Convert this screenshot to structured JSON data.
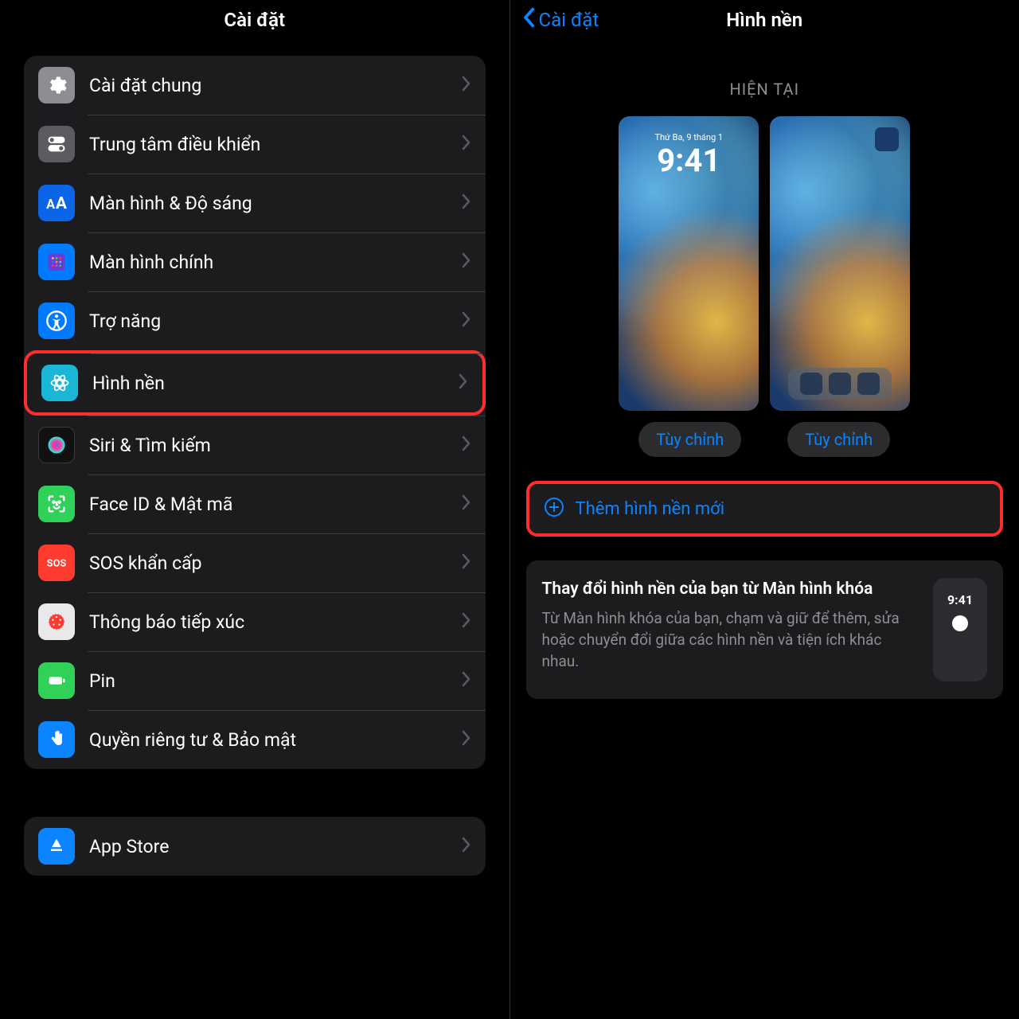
{
  "left": {
    "title": "Cài đặt",
    "rows": [
      {
        "label": "Cài đặt chung",
        "icon": "gear-icon",
        "bg": "bg-gray"
      },
      {
        "label": "Trung tâm điều khiển",
        "icon": "toggles-icon",
        "bg": "bg-darkgray"
      },
      {
        "label": "Màn hình & Độ sáng",
        "icon": "text-size-icon",
        "bg": "bg-blue"
      },
      {
        "label": "Màn hình chính",
        "icon": "apps-grid-icon",
        "bg": "bg-blue2"
      },
      {
        "label": "Trợ năng",
        "icon": "accessibility-icon",
        "bg": "bg-blue2"
      },
      {
        "label": "Hình nền",
        "icon": "wallpaper-icon",
        "bg": "bg-cyan",
        "highlight": true
      },
      {
        "label": "Siri & Tìm kiếm",
        "icon": "siri-icon",
        "bg": "bg-black"
      },
      {
        "label": "Face ID & Mật mã",
        "icon": "faceid-icon",
        "bg": "bg-green"
      },
      {
        "label": "SOS khẩn cấp",
        "icon": "sos-icon",
        "bg": "bg-red"
      },
      {
        "label": "Thông báo tiếp xúc",
        "icon": "exposure-icon",
        "bg": "bg-white"
      },
      {
        "label": "Pin",
        "icon": "battery-icon",
        "bg": "bg-green2"
      },
      {
        "label": "Quyền riêng tư & Bảo mật",
        "icon": "hand-icon",
        "bg": "bg-blue3"
      }
    ],
    "extra_row": {
      "label": "App Store",
      "icon": "appstore-icon",
      "bg": "bg-blue4"
    }
  },
  "right": {
    "back": "Cài đặt",
    "title": "Hình nền",
    "section": "HIỆN TẠI",
    "lock": {
      "date": "Thứ Ba, 9 tháng 1",
      "time": "9:41"
    },
    "customize": "Tùy chỉnh",
    "add": "Thêm hình nền mới",
    "tip_title": "Thay đổi hình nền của bạn từ Màn hình khóa",
    "tip_body": "Từ Màn hình khóa của bạn, chạm và giữ để thêm, sửa hoặc chuyển đổi giữa các hình nền và tiện ích khác nhau.",
    "tip_time": "9:41"
  }
}
